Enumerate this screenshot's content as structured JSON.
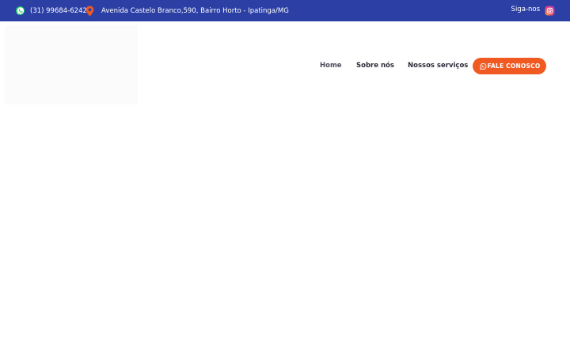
{
  "topbar": {
    "phone": "(31) 99684-6242",
    "address": "Avenida Castelo Branco,590, Bairro Horto - Ipatinga/MG",
    "social_label": "Siga-nos",
    "background_color": "#2b3fa5",
    "icons": {
      "phone": "whatsapp-icon",
      "address": "map-pin-icon",
      "social": "instagram-icon"
    }
  },
  "header": {
    "nav": {
      "home": "Home",
      "about": "Sobre nós",
      "services": "Nossos serviços"
    },
    "cta": {
      "label": "FALE CONOSCO",
      "icon": "whatsapp-icon",
      "color": "#f05a22"
    }
  }
}
